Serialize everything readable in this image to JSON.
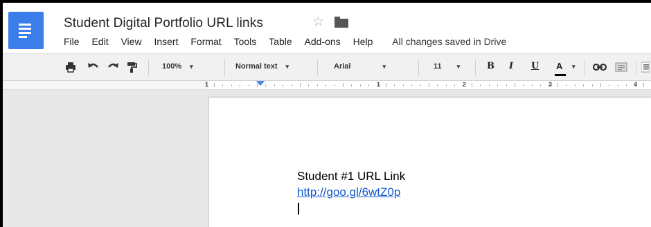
{
  "header": {
    "title": "Student Digital Portfolio URL links",
    "icons": {
      "logo": "docs-logo-icon",
      "star": "star-icon",
      "folder": "folder-icon"
    }
  },
  "menubar": {
    "items": [
      "File",
      "Edit",
      "View",
      "Insert",
      "Format",
      "Tools",
      "Table",
      "Add-ons",
      "Help"
    ],
    "status": "All changes saved in Drive"
  },
  "toolbar": {
    "zoom": "100%",
    "style": "Normal text",
    "font": "Arial",
    "size": "11",
    "bold": "B",
    "italic": "I",
    "underline": "U",
    "text_color": "A",
    "icons": [
      "print-icon",
      "undo-icon",
      "redo-icon",
      "paint-format-icon",
      "link-icon",
      "comment-icon"
    ]
  },
  "ruler": {
    "labels": [
      "1",
      "1",
      "2",
      "3",
      "4"
    ]
  },
  "document": {
    "heading": "Student #1 URL Link",
    "link": "http://goo.gl/6wtZ0p"
  },
  "colors": {
    "accent": "#3b7de9",
    "link": "#1155cc",
    "toolbar_bg": "#f1f1f1",
    "doc_bg": "#e8e8e8"
  }
}
